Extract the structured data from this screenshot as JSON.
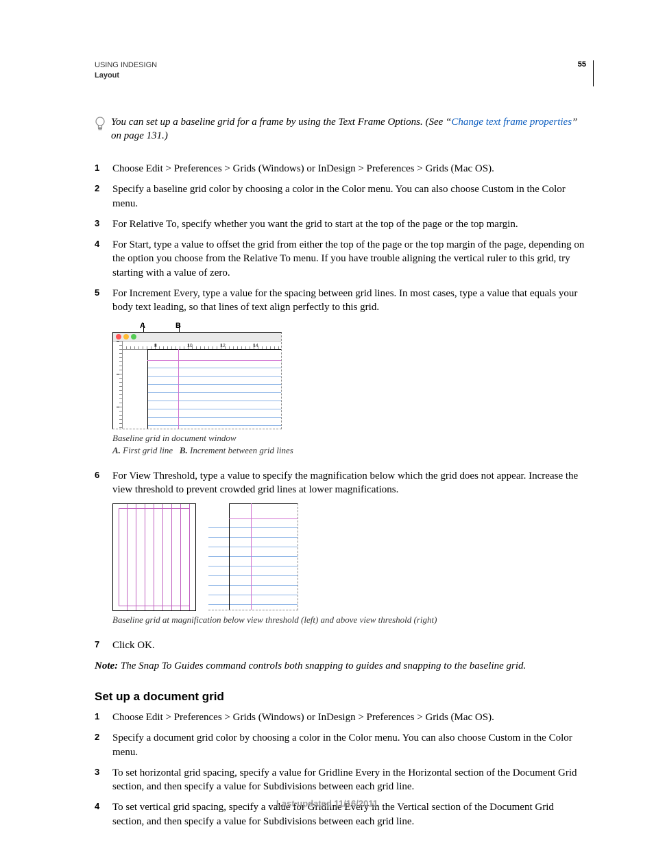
{
  "header": {
    "line1": "USING INDESIGN",
    "line2": "Layout",
    "page": "55"
  },
  "tip": {
    "pre": "You can set up a baseline grid for a frame by using the Text Frame Options. (See “",
    "link": "Change text frame properties",
    "post": "” on page 131.)"
  },
  "steps1": {
    "s1": "Choose Edit > Preferences > Grids (Windows) or InDesign > Preferences > Grids (Mac OS).",
    "s2": "Specify a baseline grid color by choosing a color in the Color menu. You can also choose Custom in the Color menu.",
    "s3": "For Relative To, specify whether you want the grid to start at the top of the page or the top margin.",
    "s4": "For Start, type a value to offset the grid from either the top of the page or the top margin of the page, depending on the option you choose from the Relative To menu. If you have trouble aligning the vertical ruler to this grid, try starting with a value of zero.",
    "s5": "For Increment Every, type a value for the spacing between grid lines. In most cases, type a value that equals your body text leading, so that lines of text align perfectly to this grid."
  },
  "fig1": {
    "labelA": "A",
    "labelB": "B",
    "ticks": [
      "8",
      "10",
      "12",
      "14"
    ],
    "caption_line1": "Baseline grid in document window",
    "caption_A_label": "A.",
    "caption_A_text": "First grid line",
    "caption_B_label": "B.",
    "caption_B_text": "Increment between grid lines"
  },
  "steps2": {
    "s6": "For View Threshold, type a value to specify the magnification below which the grid does not appear. Increase the view threshold to prevent crowded grid lines at lower magnifications."
  },
  "fig2": {
    "caption": "Baseline grid at magnification below view threshold (left) and above view threshold (right)"
  },
  "steps3": {
    "s7": "Click OK."
  },
  "note": {
    "label": "Note:",
    "text": "The Snap To Guides command controls both snapping to guides and snapping to the baseline grid."
  },
  "section2": {
    "title": "Set up a document grid",
    "s1": "Choose Edit > Preferences > Grids (Windows) or InDesign > Preferences > Grids (Mac OS).",
    "s2": "Specify a document grid color by choosing a color in the Color menu. You can also choose Custom in the Color menu.",
    "s3": "To set horizontal grid spacing, specify a value for Gridline Every in the Horizontal section of the Document Grid section, and then specify a value for Subdivisions between each grid line.",
    "s4": "To set vertical grid spacing, specify a value for Gridline Every in the Vertical section of the Document Grid section, and then specify a value for Subdivisions between each grid line."
  },
  "footer": "Last updated 11/16/2011"
}
